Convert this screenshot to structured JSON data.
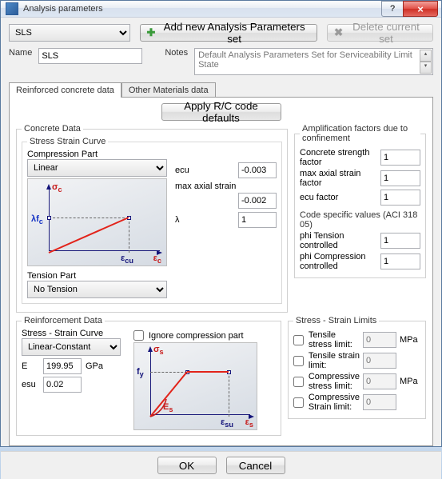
{
  "window": {
    "title": "Analysis parameters"
  },
  "top": {
    "selector": "SLS",
    "add_btn": "Add new Analysis Parameters set",
    "del_btn": "Delete current set"
  },
  "form": {
    "name_lbl": "Name",
    "name_val": "SLS",
    "notes_lbl": "Notes",
    "notes_val": "Default Analysis Parameters Set for Serviceability Limit State"
  },
  "tabs": {
    "t1": "Reinforced concrete data",
    "t2": "Other Materials data"
  },
  "apply": {
    "label": "Apply R/C code defaults"
  },
  "concrete": {
    "legend": "Concrete Data",
    "ssc_legend": "Stress Strain Curve",
    "comp_lbl": "Compression Part",
    "comp_sel": "Linear",
    "ecu_lbl": "ecu",
    "ecu_val": "-0.003",
    "max_lbl": "max axial strain",
    "max_val": "-0.002",
    "lam_lbl": "λ",
    "lam_val": "1",
    "tension_lbl": "Tension Part",
    "tension_sel": "No Tension"
  },
  "ampl": {
    "legend": "Amplification factors due to confinement",
    "csf_lbl": "Concrete strength factor",
    "csf_val": "1",
    "masf_lbl": "max axial strain factor",
    "masf_val": "1",
    "ecuf_lbl": "ecu factor",
    "ecuf_val": "1",
    "code_lbl": "Code specific values (ACI 318 05)",
    "pt_lbl": "phi Tension controlled",
    "pt_val": "1",
    "pc_lbl": "phi Compression controlled",
    "pc_val": "1"
  },
  "reinf": {
    "legend": "Reinforcement Data",
    "ssc_lbl": "Stress - Strain Curve",
    "ssc_sel": "Linear-Constant",
    "e_lbl": "E",
    "e_val": "199.95",
    "e_unit": "GPa",
    "esu_lbl": "esu",
    "esu_val": "0.02",
    "ign_lbl": "Ignore compression part"
  },
  "limits": {
    "legend": "Stress - Strain Limits",
    "tsl": "Tensile stress limit:",
    "tel": "Tensile strain limit:",
    "csl": "Compressive stress limit:",
    "cel": "Compressive Strain limit:",
    "zero": "0",
    "mpa": "MPa"
  },
  "buttons": {
    "ok": "OK",
    "cancel": "Cancel"
  },
  "glyph": {
    "sigma_c": "σ",
    "sub_c": "c",
    "lfc": "λf",
    "eps": "ε",
    "cu": "cu",
    "sigma_s": "σ",
    "sub_s": "s",
    "fy": "f",
    "fy_sub": "y",
    "Es": "E",
    "su": "su"
  }
}
